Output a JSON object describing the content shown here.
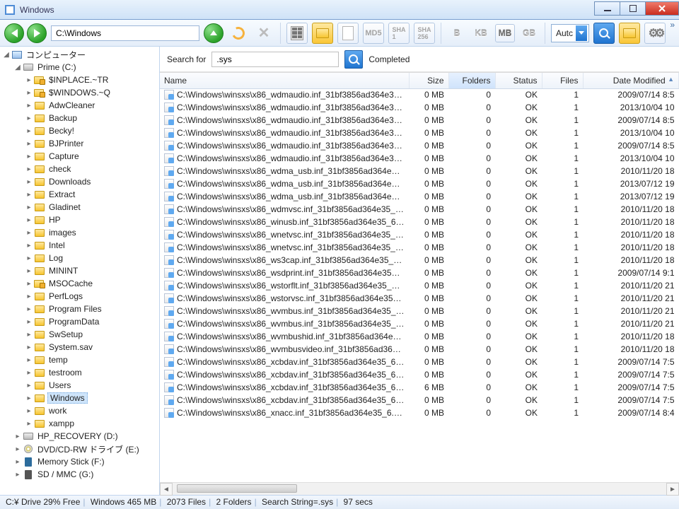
{
  "window": {
    "title": "Windows"
  },
  "address": "C:\\Windows",
  "size_units": [
    "B",
    "KB",
    "MB",
    "GB"
  ],
  "size_unit_active": "MB",
  "hash_labels": {
    "md5": "MD5",
    "sha1": "SHA\n1",
    "sha256": "SHA\n256"
  },
  "sort_dropdown": "Autc",
  "search": {
    "label": "Search for",
    "value": ".sys",
    "status": "Completed"
  },
  "columns": {
    "name": "Name",
    "size": "Size",
    "folders": "Folders",
    "status": "Status",
    "files": "Files",
    "date": "Date Modified"
  },
  "sorted_column": "folders",
  "tree": {
    "root_label": "コンピューター",
    "drive_label": "Prime (C:)",
    "folders": [
      {
        "label": "$INPLACE.~TR",
        "locked": true
      },
      {
        "label": "$WINDOWS.~Q",
        "locked": true
      },
      {
        "label": "AdwCleaner"
      },
      {
        "label": "Backup"
      },
      {
        "label": "Becky!"
      },
      {
        "label": "BJPrinter"
      },
      {
        "label": "Capture"
      },
      {
        "label": "check"
      },
      {
        "label": "Downloads"
      },
      {
        "label": "Extract"
      },
      {
        "label": "Gladinet"
      },
      {
        "label": "HP"
      },
      {
        "label": "images"
      },
      {
        "label": "Intel"
      },
      {
        "label": "Log"
      },
      {
        "label": "MININT"
      },
      {
        "label": "MSOCache",
        "locked": true
      },
      {
        "label": "PerfLogs"
      },
      {
        "label": "Program Files"
      },
      {
        "label": "ProgramData"
      },
      {
        "label": "SwSetup"
      },
      {
        "label": "System.sav"
      },
      {
        "label": "temp"
      },
      {
        "label": "testroom"
      },
      {
        "label": "Users"
      },
      {
        "label": "Windows",
        "selected": true
      },
      {
        "label": "work"
      },
      {
        "label": "xampp"
      }
    ],
    "other_drives": [
      {
        "label": "HP_RECOVERY (D:)",
        "type": "drive"
      },
      {
        "label": "DVD/CD-RW ドライブ (E:)",
        "type": "disc"
      },
      {
        "label": "Memory Stick (F:)",
        "type": "ms"
      },
      {
        "label": "SD / MMC (G:)",
        "type": "sd"
      }
    ]
  },
  "rows": [
    {
      "name": "C:\\Windows\\winsxs\\x86_wdmaudio.inf_31bf3856ad364e35_...",
      "size": "0 MB",
      "folders": 0,
      "status": "OK",
      "files": 1,
      "date": "2009/07/14 8:5"
    },
    {
      "name": "C:\\Windows\\winsxs\\x86_wdmaudio.inf_31bf3856ad364e35_...",
      "size": "0 MB",
      "folders": 0,
      "status": "OK",
      "files": 1,
      "date": "2013/10/04 10"
    },
    {
      "name": "C:\\Windows\\winsxs\\x86_wdmaudio.inf_31bf3856ad364e35_...",
      "size": "0 MB",
      "folders": 0,
      "status": "OK",
      "files": 1,
      "date": "2009/07/14 8:5"
    },
    {
      "name": "C:\\Windows\\winsxs\\x86_wdmaudio.inf_31bf3856ad364e35_...",
      "size": "0 MB",
      "folders": 0,
      "status": "OK",
      "files": 1,
      "date": "2013/10/04 10"
    },
    {
      "name": "C:\\Windows\\winsxs\\x86_wdmaudio.inf_31bf3856ad364e35_...",
      "size": "0 MB",
      "folders": 0,
      "status": "OK",
      "files": 1,
      "date": "2009/07/14 8:5"
    },
    {
      "name": "C:\\Windows\\winsxs\\x86_wdmaudio.inf_31bf3856ad364e35_...",
      "size": "0 MB",
      "folders": 0,
      "status": "OK",
      "files": 1,
      "date": "2013/10/04 10"
    },
    {
      "name": "C:\\Windows\\winsxs\\x86_wdma_usb.inf_31bf3856ad364e35_...",
      "size": "0 MB",
      "folders": 0,
      "status": "OK",
      "files": 1,
      "date": "2010/11/20 18"
    },
    {
      "name": "C:\\Windows\\winsxs\\x86_wdma_usb.inf_31bf3856ad364e35_...",
      "size": "0 MB",
      "folders": 0,
      "status": "OK",
      "files": 1,
      "date": "2013/07/12 19"
    },
    {
      "name": "C:\\Windows\\winsxs\\x86_wdma_usb.inf_31bf3856ad364e35_...",
      "size": "0 MB",
      "folders": 0,
      "status": "OK",
      "files": 1,
      "date": "2013/07/12 19"
    },
    {
      "name": "C:\\Windows\\winsxs\\x86_wdmvsc.inf_31bf3856ad364e35_6.1...",
      "size": "0 MB",
      "folders": 0,
      "status": "OK",
      "files": 1,
      "date": "2010/11/20 18"
    },
    {
      "name": "C:\\Windows\\winsxs\\x86_winusb.inf_31bf3856ad364e35_6.1....",
      "size": "0 MB",
      "folders": 0,
      "status": "OK",
      "files": 1,
      "date": "2010/11/20 18"
    },
    {
      "name": "C:\\Windows\\winsxs\\x86_wnetvsc.inf_31bf3856ad364e35_6.1...",
      "size": "0 MB",
      "folders": 0,
      "status": "OK",
      "files": 1,
      "date": "2010/11/20 18"
    },
    {
      "name": "C:\\Windows\\winsxs\\x86_wnetvsc.inf_31bf3856ad364e35_6.1...",
      "size": "0 MB",
      "folders": 0,
      "status": "OK",
      "files": 1,
      "date": "2010/11/20 18"
    },
    {
      "name": "C:\\Windows\\winsxs\\x86_ws3cap.inf_31bf3856ad364e35_6.1....",
      "size": "0 MB",
      "folders": 0,
      "status": "OK",
      "files": 1,
      "date": "2010/11/20 18"
    },
    {
      "name": "C:\\Windows\\winsxs\\x86_wsdprint.inf_31bf3856ad364e35_6.1...",
      "size": "0 MB",
      "folders": 0,
      "status": "OK",
      "files": 1,
      "date": "2009/07/14 9:1"
    },
    {
      "name": "C:\\Windows\\winsxs\\x86_wstorflt.inf_31bf3856ad364e35_6.1...",
      "size": "0 MB",
      "folders": 0,
      "status": "OK",
      "files": 1,
      "date": "2010/11/20 21"
    },
    {
      "name": "C:\\Windows\\winsxs\\x86_wstorvsc.inf_31bf3856ad364e35_6.1...",
      "size": "0 MB",
      "folders": 0,
      "status": "OK",
      "files": 1,
      "date": "2010/11/20 21"
    },
    {
      "name": "C:\\Windows\\winsxs\\x86_wvmbus.inf_31bf3856ad364e35_6.1...",
      "size": "0 MB",
      "folders": 0,
      "status": "OK",
      "files": 1,
      "date": "2010/11/20 21"
    },
    {
      "name": "C:\\Windows\\winsxs\\x86_wvmbus.inf_31bf3856ad364e35_6.1...",
      "size": "0 MB",
      "folders": 0,
      "status": "OK",
      "files": 1,
      "date": "2010/11/20 21"
    },
    {
      "name": "C:\\Windows\\winsxs\\x86_wvmbushid.inf_31bf3856ad364e35...",
      "size": "0 MB",
      "folders": 0,
      "status": "OK",
      "files": 1,
      "date": "2010/11/20 18"
    },
    {
      "name": "C:\\Windows\\winsxs\\x86_wvmbusvideo.inf_31bf3856ad364e...",
      "size": "0 MB",
      "folders": 0,
      "status": "OK",
      "files": 1,
      "date": "2010/11/20 18"
    },
    {
      "name": "C:\\Windows\\winsxs\\x86_xcbdav.inf_31bf3856ad364e35_6.1.7...",
      "size": "0 MB",
      "folders": 0,
      "status": "OK",
      "files": 1,
      "date": "2009/07/14 7:5"
    },
    {
      "name": "C:\\Windows\\winsxs\\x86_xcbdav.inf_31bf3856ad364e35_6.1.7...",
      "size": "0 MB",
      "folders": 0,
      "status": "OK",
      "files": 1,
      "date": "2009/07/14 7:5"
    },
    {
      "name": "C:\\Windows\\winsxs\\x86_xcbdav.inf_31bf3856ad364e35_6.1.7...",
      "size": "6 MB",
      "folders": 0,
      "status": "OK",
      "files": 1,
      "date": "2009/07/14 7:5"
    },
    {
      "name": "C:\\Windows\\winsxs\\x86_xcbdav.inf_31bf3856ad364e35_6.1.7...",
      "size": "0 MB",
      "folders": 0,
      "status": "OK",
      "files": 1,
      "date": "2009/07/14 7:5"
    },
    {
      "name": "C:\\Windows\\winsxs\\x86_xnacc.inf_31bf3856ad364e35_6.1.76...",
      "size": "0 MB",
      "folders": 0,
      "status": "OK",
      "files": 1,
      "date": "2009/07/14 8:4"
    }
  ],
  "statusbar": {
    "drive": "C:¥ Drive 29% Free",
    "folder": "Windows 465  MB",
    "files": "2073 Files",
    "folders": "2 Folders",
    "search": "Search String=.sys",
    "time": "97 secs"
  }
}
